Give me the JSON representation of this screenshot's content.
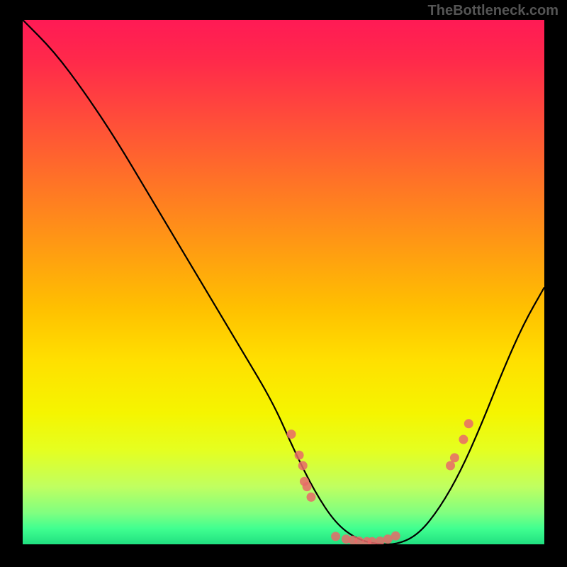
{
  "watermark": "TheBottleneck.com",
  "chart_data": {
    "type": "line",
    "title": "",
    "xlabel": "",
    "ylabel": "",
    "xlim": [
      0,
      100
    ],
    "ylim": [
      0,
      100
    ],
    "series": [
      {
        "name": "curve",
        "x": [
          0,
          6,
          12,
          18,
          24,
          30,
          36,
          42,
          48,
          52,
          56,
          60,
          64,
          68,
          72,
          76,
          80,
          84,
          88,
          92,
          96,
          100
        ],
        "y": [
          100,
          94,
          86,
          77,
          67,
          57,
          47,
          37,
          27,
          18,
          10,
          4,
          1,
          0,
          0,
          2,
          7,
          14,
          23,
          33,
          42,
          49
        ]
      }
    ],
    "markers": [
      {
        "x": 51.5,
        "y": 21
      },
      {
        "x": 53,
        "y": 17
      },
      {
        "x": 53.7,
        "y": 15
      },
      {
        "x": 54,
        "y": 12
      },
      {
        "x": 54.5,
        "y": 11
      },
      {
        "x": 55.3,
        "y": 9
      },
      {
        "x": 60,
        "y": 1.5
      },
      {
        "x": 62,
        "y": 1
      },
      {
        "x": 63.3,
        "y": 0.8
      },
      {
        "x": 64.5,
        "y": 0.6
      },
      {
        "x": 66,
        "y": 0.5
      },
      {
        "x": 67,
        "y": 0.5
      },
      {
        "x": 68.5,
        "y": 0.6
      },
      {
        "x": 70,
        "y": 1
      },
      {
        "x": 71.5,
        "y": 1.6
      },
      {
        "x": 82,
        "y": 15
      },
      {
        "x": 82.8,
        "y": 16.5
      },
      {
        "x": 84.5,
        "y": 20
      },
      {
        "x": 85.5,
        "y": 23
      }
    ],
    "gradient_stops": [
      {
        "pos": 0,
        "color": "#ff1a55"
      },
      {
        "pos": 50,
        "color": "#ffc000"
      },
      {
        "pos": 100,
        "color": "#20e080"
      }
    ]
  }
}
